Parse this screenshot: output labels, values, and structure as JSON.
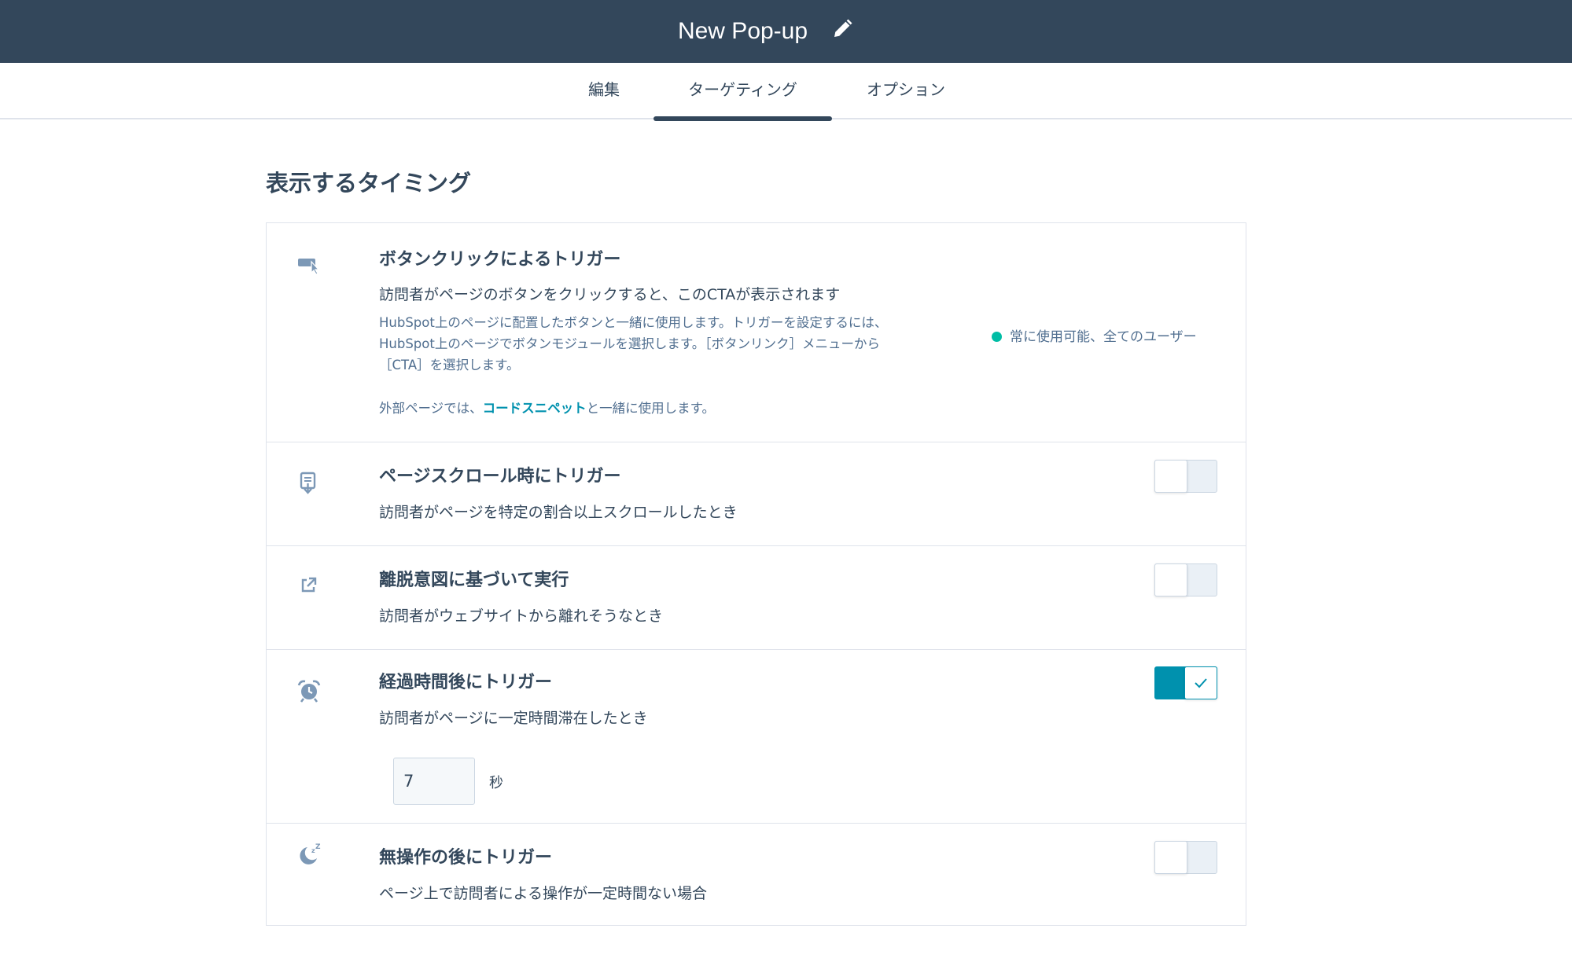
{
  "header": {
    "title": "New Pop-up"
  },
  "tabs": [
    {
      "label": "編集",
      "active": false
    },
    {
      "label": "ターゲティング",
      "active": true
    },
    {
      "label": "オプション",
      "active": false
    }
  ],
  "section": {
    "title": "表示するタイミング"
  },
  "triggers": {
    "button_click": {
      "icon": "button-click-icon",
      "title": "ボタンクリックによるトリガー",
      "desc": "訪問者がページのボタンをクリックすると、このCTAが表示されます",
      "note_line1": "HubSpot上のページに配置したボタンと一緒に使用します。トリガーを設定するには、",
      "note_line2": "HubSpot上のページでボタンモジュールを選択します。［ボタンリンク］メニューから",
      "note_line3": "［CTA］を選択します。",
      "external_prefix": "外部ページでは、",
      "external_link": "コードスニペット",
      "external_suffix": "と一緒に使用します。",
      "availability": "常に使用可能、全てのユーザー",
      "availability_color": "#00bda5"
    },
    "scroll": {
      "icon": "scroll-down-icon",
      "title": "ページスクロール時にトリガー",
      "desc": "訪問者がページを特定の割合以上スクロールしたとき",
      "enabled": false
    },
    "exit_intent": {
      "icon": "external-link-icon",
      "title": "離脱意図に基づいて実行",
      "desc": "訪問者がウェブサイトから離れそうなとき",
      "enabled": false
    },
    "elapsed_time": {
      "icon": "alarm-clock-icon",
      "title": "経過時間後にトリガー",
      "desc": "訪問者がページに一定時間滞在したとき",
      "enabled": true,
      "seconds_value": "7",
      "unit": "秒"
    },
    "inactivity": {
      "icon": "sleep-moon-icon",
      "title": "無操作の後にトリガー",
      "desc": "ページ上で訪問者による操作が一定時間ない場合",
      "enabled": false
    }
  },
  "colors": {
    "header_bg": "#33475b",
    "accent": "#0091ae",
    "success": "#00bda5"
  }
}
